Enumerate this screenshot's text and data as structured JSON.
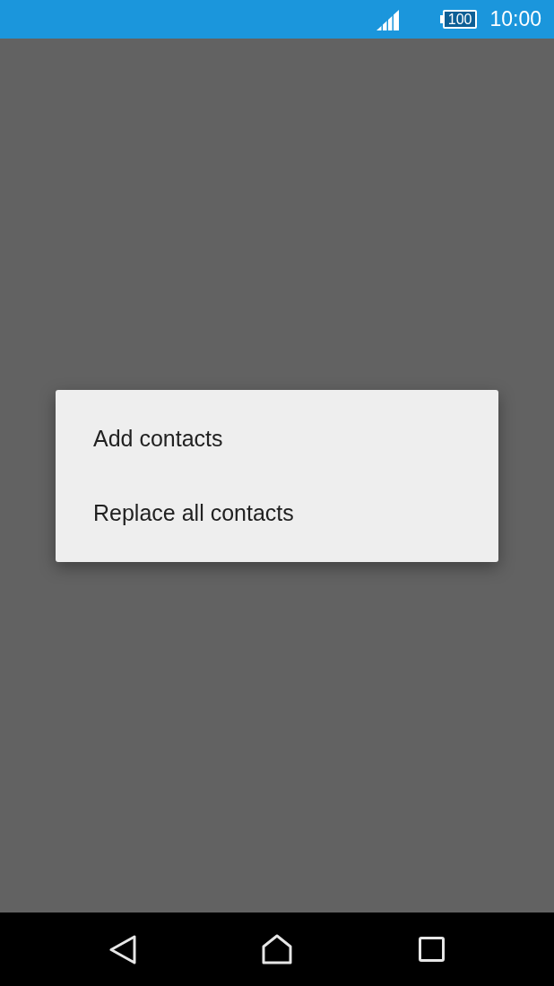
{
  "status_bar": {
    "battery": "100",
    "time": "10:00"
  },
  "menu": {
    "items": [
      {
        "label": "Add contacts"
      },
      {
        "label": "Replace all contacts"
      }
    ]
  }
}
